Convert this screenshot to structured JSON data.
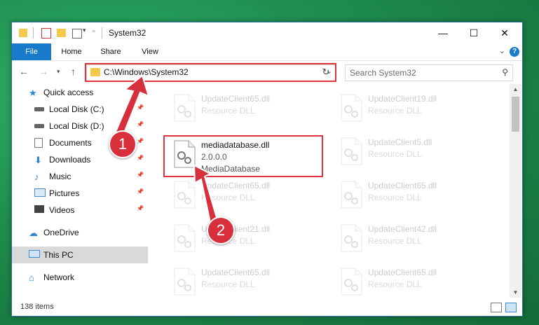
{
  "window": {
    "title": "System32"
  },
  "ribbon": {
    "tabs": [
      "File",
      "Home",
      "Share",
      "View"
    ]
  },
  "address": {
    "path": "C:\\Windows\\System32"
  },
  "search": {
    "placeholder": "Search System32"
  },
  "nav": {
    "items": [
      {
        "label": "Quick access",
        "icon": "star-icon",
        "pinned": false
      },
      {
        "label": "Local Disk (C:)",
        "icon": "drive-icon",
        "pinned": true
      },
      {
        "label": "Local Disk (D:)",
        "icon": "drive-icon",
        "pinned": true
      },
      {
        "label": "Documents",
        "icon": "documents-icon",
        "pinned": true
      },
      {
        "label": "Downloads",
        "icon": "downloads-icon",
        "pinned": true
      },
      {
        "label": "Music",
        "icon": "music-icon",
        "pinned": true
      },
      {
        "label": "Pictures",
        "icon": "pictures-icon",
        "pinned": true
      },
      {
        "label": "Videos",
        "icon": "videos-icon",
        "pinned": true
      },
      {
        "label": "OneDrive",
        "icon": "cloud-icon",
        "pinned": false
      },
      {
        "label": "This PC",
        "icon": "pc-icon",
        "pinned": false,
        "selected": true
      },
      {
        "label": "Network",
        "icon": "network-icon",
        "pinned": false
      }
    ]
  },
  "files": [
    {
      "name": "UpdateClient65.dll",
      "desc": "Resource DLL"
    },
    {
      "name": "UpdateClient19.dll",
      "desc": "Resource DLL"
    },
    {
      "name": "mediadatabase.dll",
      "version": "2.0.0.0",
      "desc": "MediaDatabase",
      "highlighted": true
    },
    {
      "name": "UpdateClient5.dll",
      "desc": "Resource DLL"
    },
    {
      "name": "UpdateClient65.dll",
      "desc": "Resource DLL"
    },
    {
      "name": "UpdateClient65.dll",
      "desc": "Resource DLL"
    },
    {
      "name": "UpdateClient21.dll",
      "desc": "Resource DLL"
    },
    {
      "name": "UpdateClient42.dll",
      "desc": "Resource DLL"
    },
    {
      "name": "UpdateClient65.dll",
      "desc": "Resource DLL"
    },
    {
      "name": "UpdateClient65.dll",
      "desc": "Resource DLL"
    }
  ],
  "status": {
    "items": "138 items"
  },
  "callouts": [
    "1",
    "2"
  ],
  "colors": {
    "accent": "#1979ca",
    "highlight": "#e0333b",
    "callout": "#d82f3c"
  }
}
